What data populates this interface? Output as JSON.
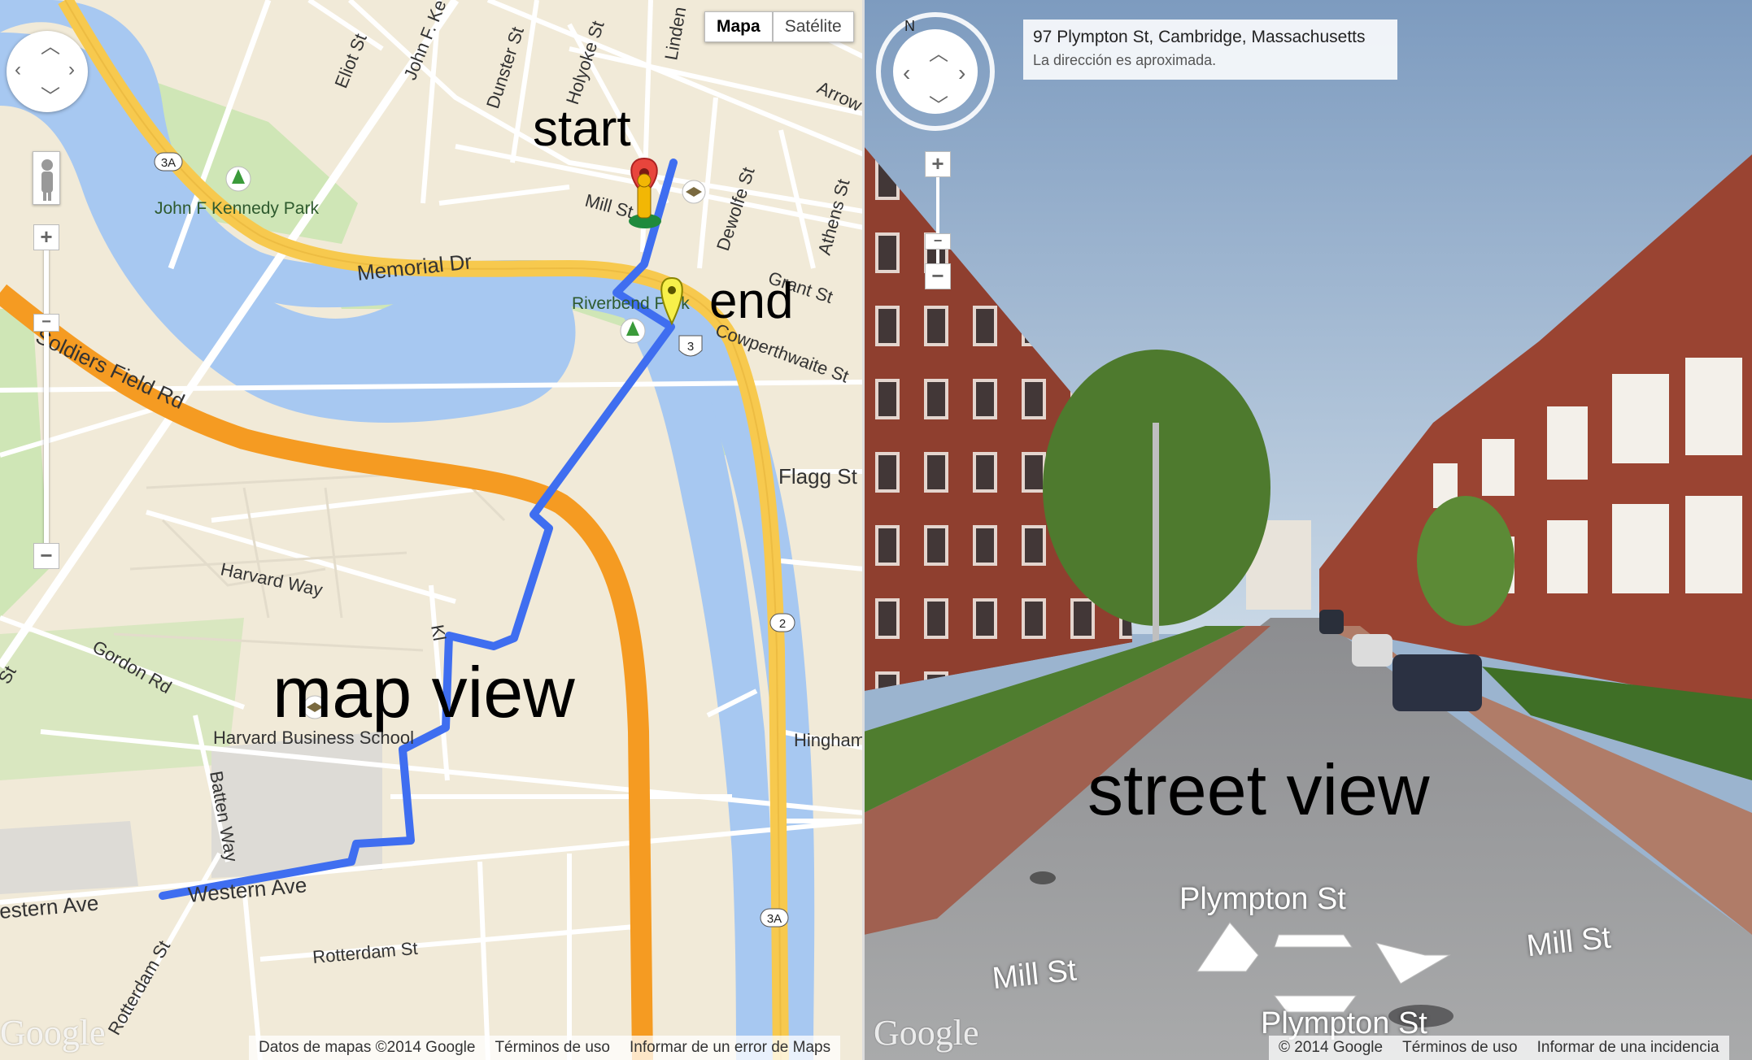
{
  "map": {
    "maptype_buttons": [
      "Mapa",
      "Satélite"
    ],
    "maptype_selected": "Mapa",
    "annotations": {
      "start": "start",
      "end": "end",
      "view": "map view"
    },
    "zoom": {
      "in": "+",
      "out": "−"
    },
    "streets": {
      "eliot": "Eliot St",
      "john_f": "John F. Ke",
      "dunster": "Dunster St",
      "holyoke": "Holyoke St",
      "linden": "Linden",
      "arrow": "Arrow St",
      "mill": "Mill St",
      "dewolfe": "Dewolfe St",
      "athens": "Athens St",
      "grant": "Grant St",
      "memorial": "Memorial Dr",
      "cowperthwaite": "Cowperthwaite St",
      "soldiers": "Soldiers Field Rd",
      "flagg": "Flagg St",
      "harvard_way": "Harvard Way",
      "gordon": "Gordon Rd",
      "batten": "Batten Way",
      "hingham": "Hingham",
      "western": "Western Ave",
      "western_left": "estern Ave",
      "rotterdam": "Rotterdam St",
      "rotterdam2": "Rotterdam St",
      "kl": "Kl",
      "st_left": "St"
    },
    "places": {
      "jfk_park": "John F Kennedy Park",
      "riverbend": "Riverbend Park",
      "hbs": "Harvard Business School"
    },
    "route_shields": {
      "r3a_top": "3A",
      "r3": "3",
      "r2": "2",
      "r3a_bottom": "3A"
    },
    "footer": [
      "Datos de mapas ©2014 Google",
      "Términos de uso",
      "Informar de un error de Maps"
    ],
    "logo": "Google",
    "colors": {
      "water": "#a7c8f1",
      "major_road": "#f7c94e",
      "highway": "#f59b22",
      "route": "#3f6ef0",
      "park": "#cfe6b6",
      "land": "#f1ead8"
    }
  },
  "street_view": {
    "address_line1": "97 Plympton St, Cambridge, Massachusetts",
    "address_line2": "La dirección es aproximada.",
    "compass": "N",
    "annotation": "street view",
    "labels": {
      "plympton_top": "Plympton St",
      "plympton_bottom": "Plympton St",
      "mill_left": "Mill St",
      "mill_right": "Mill St"
    },
    "watermark": "© 2014 Google",
    "footer": [
      "© 2014 Google",
      "Términos de uso",
      "Informar de una incidencia"
    ],
    "logo": "Google",
    "zoom": {
      "in": "+",
      "out": "−"
    }
  }
}
